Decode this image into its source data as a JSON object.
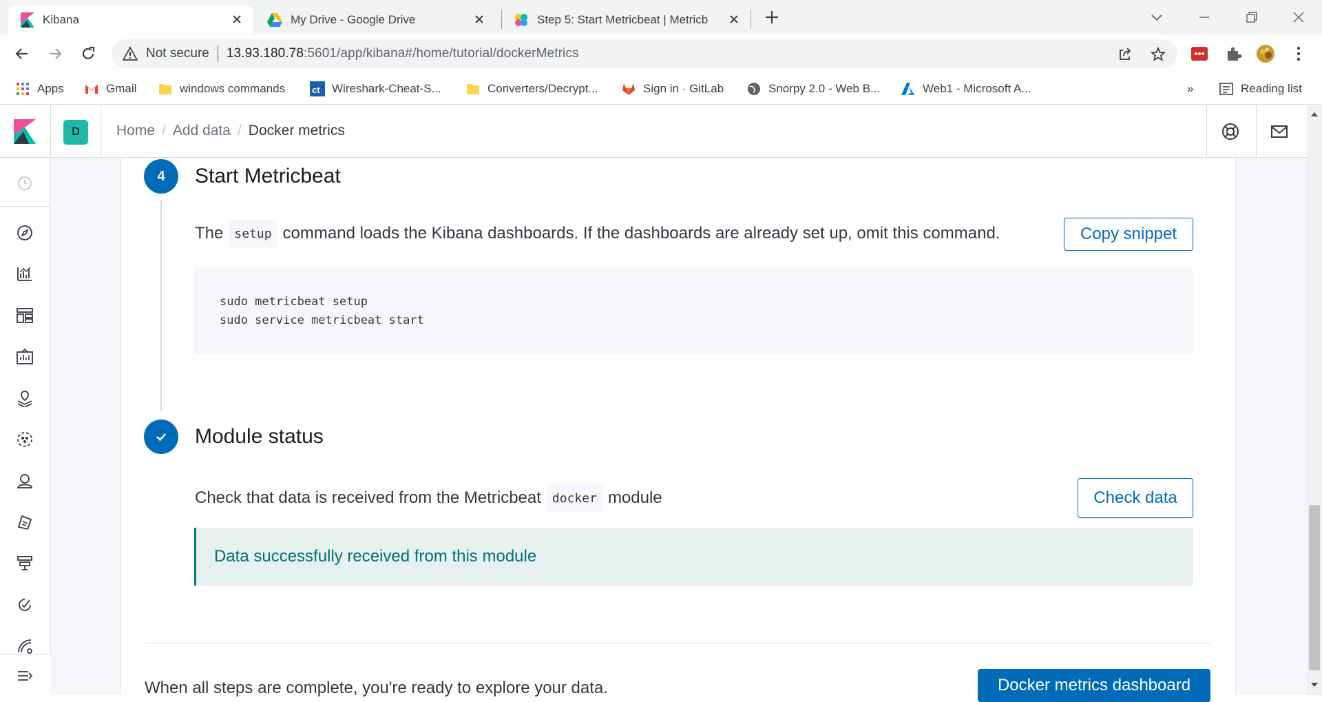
{
  "browser": {
    "tabs": [
      {
        "title": "Kibana",
        "icon": "kibana-logo-icon",
        "active": true
      },
      {
        "title": "My Drive - Google Drive",
        "icon": "google-drive-icon",
        "active": false
      },
      {
        "title": "Step 5: Start Metricbeat | Metricb",
        "icon": "elastic-logo-icon",
        "active": false
      }
    ],
    "address": {
      "security_label": "Not secure",
      "host": "13.93.180.78",
      "path": ":5601/app/kibana#/home/tutorial/dockerMetrics"
    },
    "bookmarks": [
      {
        "label": "Apps",
        "icon": "apps-grid-icon"
      },
      {
        "label": "Gmail",
        "icon": "gmail-icon"
      },
      {
        "label": "windows commands",
        "icon": "folder-icon"
      },
      {
        "label": "Wireshark-Cheat-S...",
        "icon": "ct-icon"
      },
      {
        "label": "Converters/Decrypt...",
        "icon": "folder-icon"
      },
      {
        "label": "Sign in · GitLab",
        "icon": "gitlab-icon"
      },
      {
        "label": "Snorpy 2.0 - Web B...",
        "icon": "globe-icon"
      },
      {
        "label": "Web1 - Microsoft A...",
        "icon": "azure-icon"
      }
    ],
    "overflow_label": "»",
    "reading_list_label": "Reading list",
    "colors": {
      "accent": "#006bb8",
      "success": "#017d73"
    }
  },
  "kibana": {
    "space_initial": "D",
    "breadcrumbs": {
      "home": "Home",
      "sep": "/",
      "add_data": "Add data",
      "current": "Docker metrics"
    },
    "nav_icons": [
      "clock-icon",
      "compass-icon",
      "visualize-icon",
      "dashboard-icon",
      "canvas-icon",
      "maps-icon",
      "ml-icon",
      "infrastructure-icon",
      "logs-icon",
      "apm-icon",
      "uptime-icon",
      "dev-tools-icon",
      "monitoring-icon",
      "collapse-nav-icon"
    ]
  },
  "steps": [
    {
      "number": "4",
      "title": "Start Metricbeat",
      "text_before": "The",
      "code_inline": "setup",
      "text_after": "command loads the Kibana dashboards. If the dashboards are already set up, omit this command.",
      "button": "Copy snippet",
      "code_lines": [
        "sudo metricbeat setup",
        "sudo service metricbeat start"
      ]
    },
    {
      "title": "Module status",
      "text_before": "Check that data is received from the Metricbeat",
      "code_inline": "docker",
      "text_after": "module",
      "button": "Check data",
      "callout": "Data successfully received from this module"
    }
  ],
  "footer": {
    "text": "When all steps are complete, you're ready to explore your data.",
    "button": "Docker metrics dashboard"
  }
}
